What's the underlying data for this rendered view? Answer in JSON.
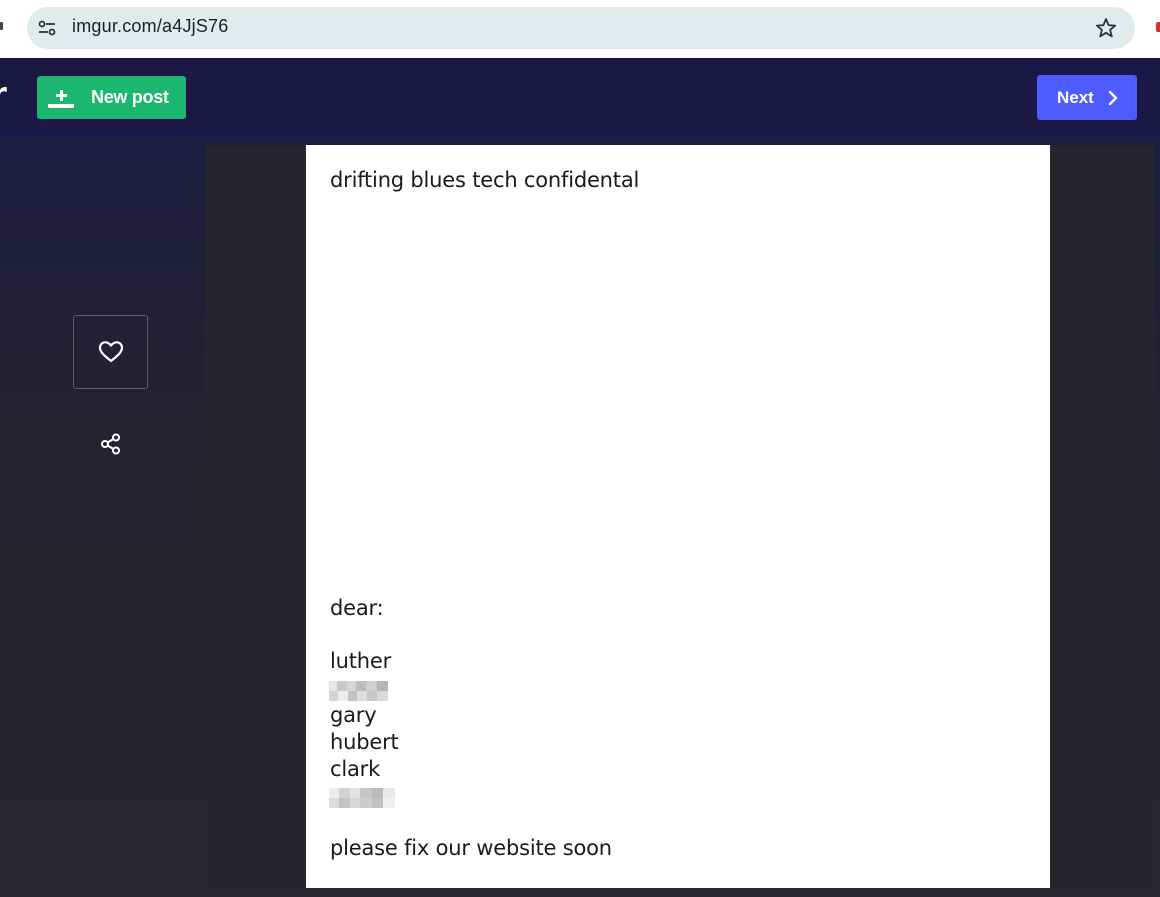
{
  "browser": {
    "url": "imgur.com/a4JjS76"
  },
  "header": {
    "logo_fragment": "r",
    "new_post_label": "New post",
    "next_label": "Next"
  },
  "post": {
    "title_line": "drifting blues tech confidental",
    "greeting": "dear:",
    "names": [
      "luther",
      "gary",
      "hubert",
      "clark"
    ],
    "closing": "please fix our website soon"
  },
  "colors": {
    "header_bg": "#1b1845",
    "new_post_green": "#1bb76e",
    "next_blue": "#4e5cff"
  }
}
